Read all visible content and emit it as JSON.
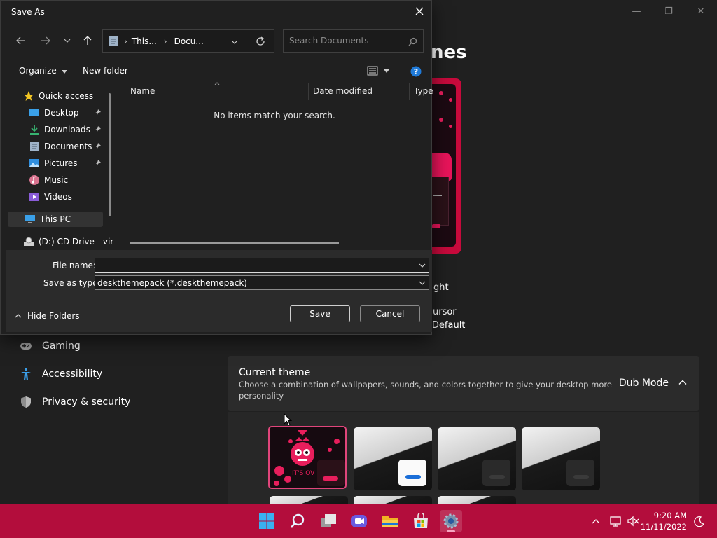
{
  "dialog": {
    "title": "Save As",
    "address": {
      "seg1": "This...",
      "seg2": "Docu..."
    },
    "search_placeholder": "Search Documents",
    "toolbar": {
      "organize": "Organize",
      "new_folder": "New folder"
    },
    "nav": [
      {
        "label": "Quick access",
        "icon": "star-icon"
      },
      {
        "label": "Desktop",
        "icon": "desktop-icon",
        "pinned": true
      },
      {
        "label": "Downloads",
        "icon": "download-icon",
        "pinned": true
      },
      {
        "label": "Documents",
        "icon": "documents-icon",
        "pinned": true
      },
      {
        "label": "Pictures",
        "icon": "pictures-icon",
        "pinned": true
      },
      {
        "label": "Music",
        "icon": "music-icon"
      },
      {
        "label": "Videos",
        "icon": "videos-icon"
      },
      {
        "label": "This PC",
        "icon": "pc-icon",
        "selected": true
      },
      {
        "label": "(D:) CD Drive - vir",
        "icon": "cd-drive-icon"
      }
    ],
    "columns": {
      "name": "Name",
      "date": "Date modified",
      "type": "Type"
    },
    "empty_message": "No items match your search.",
    "file_name_label": "File name:",
    "file_name_value": "",
    "save_type_label": "Save as type:",
    "save_type_value": "deskthemepack (*.deskthemepack)",
    "hide_folders": "Hide Folders",
    "save": "Save",
    "cancel": "Cancel"
  },
  "settings": {
    "title_fragment": "nes",
    "peek": {
      "light": "ght",
      "cursor": "ursor",
      "default": "s Default"
    },
    "nav": [
      {
        "label": "Gaming",
        "icon": "gaming-icon"
      },
      {
        "label": "Accessibility",
        "icon": "accessibility-icon"
      },
      {
        "label": "Privacy & security",
        "icon": "shield-icon"
      }
    ],
    "current_theme": {
      "title": "Current theme",
      "description": "Choose a combination of wallpapers, sounds, and colors together to give your desktop more personality",
      "value": "Dub Mode"
    }
  },
  "taskbar": {
    "icons": [
      "start-icon",
      "search-icon",
      "task-view-icon",
      "chat-icon",
      "file-explorer-icon",
      "store-icon",
      "settings-icon"
    ],
    "active": "settings-icon",
    "time": "9:20 AM",
    "date": "11/11/2022"
  },
  "colors": {
    "accent": "#b30d3c",
    "pink": "#e81e5c",
    "link": "#1a6ed8"
  }
}
